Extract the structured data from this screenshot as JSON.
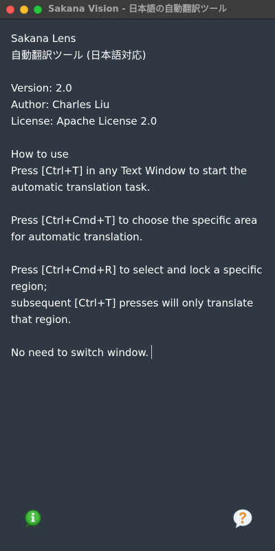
{
  "window": {
    "title": "Sakana Vision - 日本語の自動翻訳ツール"
  },
  "content": {
    "lines": [
      "Sakana Lens",
      "自動翻訳ツール (日本語対応)",
      "",
      "Version: 2.0",
      "Author: Charles Liu",
      "License: Apache License 2.0",
      "",
      "How to use",
      "Press [Ctrl+T] in any Text Window to start the",
      "automatic translation task.",
      "",
      "Press [Ctrl+Cmd+T] to choose the specific area",
      "for automatic translation.",
      "",
      "Press [Ctrl+Cmd+R] to select and lock a specific",
      "region;",
      "subsequent [Ctrl+T] presses will only translate",
      "that region.",
      "",
      "No need to switch window."
    ]
  },
  "icons": {
    "info": "info-icon",
    "help": "help-icon"
  },
  "colors": {
    "background": "#2f3843",
    "text": "#ffffff",
    "info_green": "#3aa935",
    "help_orange": "#f08a24"
  }
}
